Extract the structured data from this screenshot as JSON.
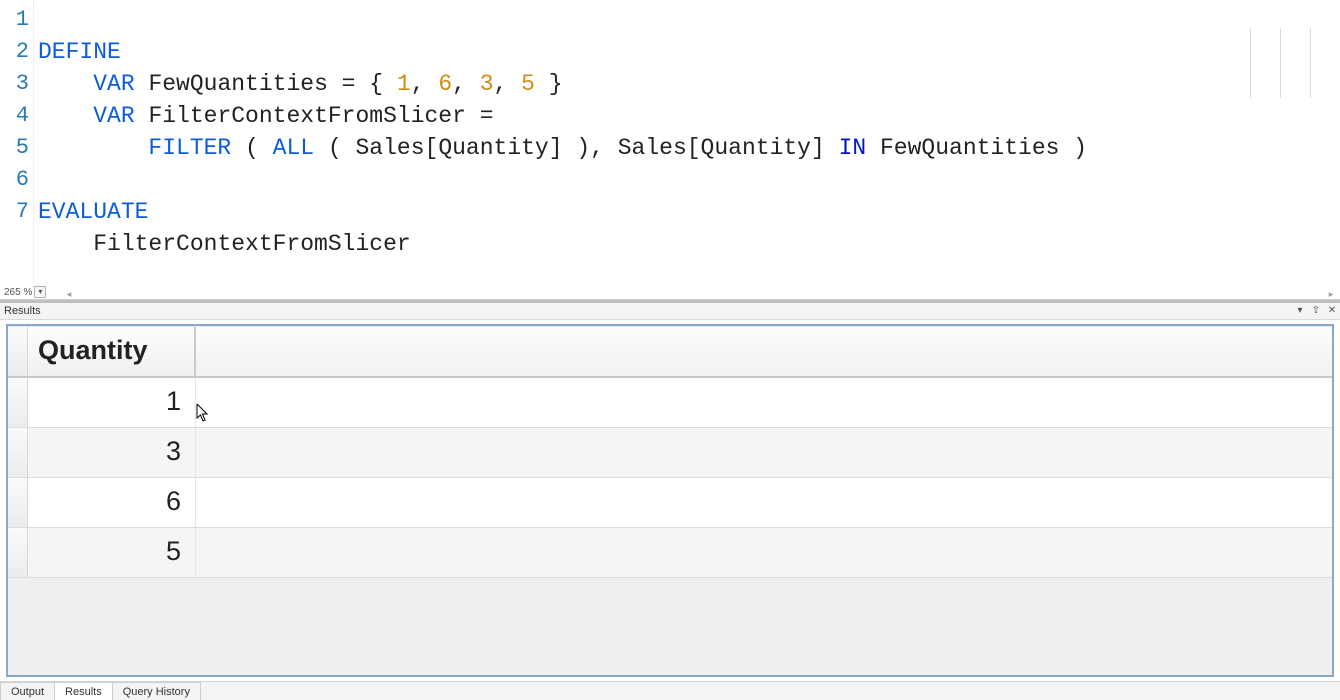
{
  "editor": {
    "line_numbers": [
      "1",
      "2",
      "3",
      "4",
      "5",
      "6",
      "7"
    ],
    "tokens": {
      "l1": {
        "define": "DEFINE"
      },
      "l2": {
        "indent": "    ",
        "var": "VAR",
        "name": " FewQuantities = { ",
        "n1": "1",
        "c1": ", ",
        "n2": "6",
        "c2": ", ",
        "n3": "3",
        "c3": ", ",
        "n4": "5",
        "close": " }"
      },
      "l3": {
        "indent": "    ",
        "var": "VAR",
        "name": " FilterContextFromSlicer ="
      },
      "l4": {
        "indent": "        ",
        "filter": "FILTER",
        "p1": " ( ",
        "all": "ALL",
        "p2": " ( Sales[Quantity] ), Sales[Quantity] ",
        "in": "IN",
        "p3": " FewQuantities )"
      },
      "l5": {
        "blank": ""
      },
      "l6": {
        "evaluate": "EVALUATE"
      },
      "l7": {
        "indent": "    ",
        "expr": "FilterContextFromSlicer"
      }
    },
    "zoom_label": "265 %"
  },
  "results": {
    "panel_title": "Results",
    "header": "Quantity",
    "rows": [
      "1",
      "3",
      "6",
      "5"
    ]
  },
  "tabs": {
    "output": "Output",
    "results": "Results",
    "history": "Query History"
  },
  "icons": {
    "dropdown": "▾",
    "pin": "⇧",
    "close": "✕",
    "left": "◂",
    "right": "▸"
  }
}
